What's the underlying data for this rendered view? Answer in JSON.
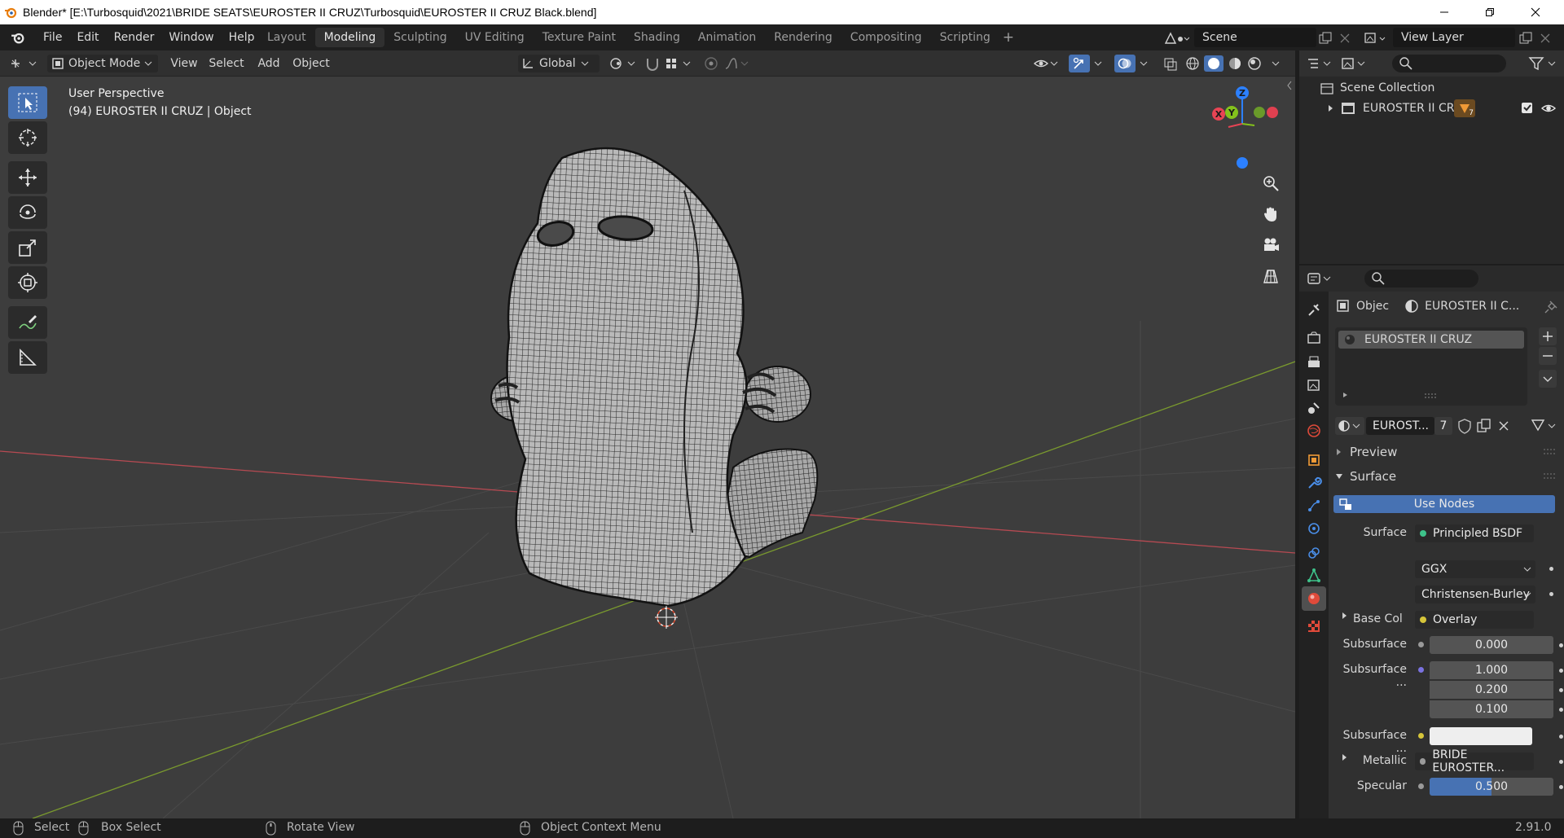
{
  "window": {
    "title": "Blender* [E:\\Turbosquid\\2021\\BRIDE SEATS\\EUROSTER II CRUZ\\Turbosquid\\EUROSTER II CRUZ Black.blend]"
  },
  "menu": [
    "File",
    "Edit",
    "Render",
    "Window",
    "Help"
  ],
  "workspaces": [
    "Layout",
    "Modeling",
    "Sculpting",
    "UV Editing",
    "Texture Paint",
    "Shading",
    "Animation",
    "Rendering",
    "Compositing",
    "Scripting"
  ],
  "active_workspace": "Modeling",
  "scene": {
    "name": "Scene",
    "view_layer": "View Layer"
  },
  "viewport_header": {
    "mode": "Object Mode",
    "menus": [
      "View",
      "Select",
      "Add",
      "Object"
    ],
    "orientation": "Global"
  },
  "viewport": {
    "perspective": "User Perspective",
    "object_info": "(94) EUROSTER II CRUZ | Object",
    "gizmo": {
      "x": "X",
      "y": "Y",
      "z": "Z"
    }
  },
  "outliner": {
    "root": "Scene Collection",
    "items": [
      {
        "name": "EUROSTER II CRUZ",
        "badge": "7"
      }
    ]
  },
  "properties": {
    "breadcrumb": {
      "object": "Objec",
      "material": "EUROSTER II C..."
    },
    "material_slot": "EUROSTER II CRUZ",
    "material_name": "EUROST...",
    "users": "7",
    "panels": {
      "preview": "Preview",
      "surface": "Surface"
    },
    "use_nodes": "Use Nodes",
    "rows": {
      "surface_label": "Surface",
      "surface_value": "Principled BSDF",
      "distribution": "GGX",
      "subsurface_method": "Christensen-Burley",
      "base_color_label": "Base Col",
      "base_color_value": "Overlay",
      "subsurface_label": "Subsurface",
      "subsurface_value": "0.000",
      "subsurface_radius_label": "Subsurface ...",
      "subsurface_radius": [
        "1.000",
        "0.200",
        "0.100"
      ],
      "subsurface_color_label": "Subsurface ...",
      "metallic_label": "Metallic",
      "metallic_value": "BRIDE EUROSTER...",
      "specular_label": "Specular",
      "specular_value": "0.500"
    }
  },
  "status_bar": {
    "select": "Select",
    "box_select": "Box Select",
    "rotate": "Rotate View",
    "context": "Object Context Menu",
    "version": "2.91.0"
  },
  "colors": {
    "accent": "#4772b3",
    "viewport_bg": "#3d3d3d",
    "panel_bg": "#303030",
    "x_axis": "#e84454",
    "y_axis": "#84c21c",
    "z_axis": "#2c80ff"
  }
}
